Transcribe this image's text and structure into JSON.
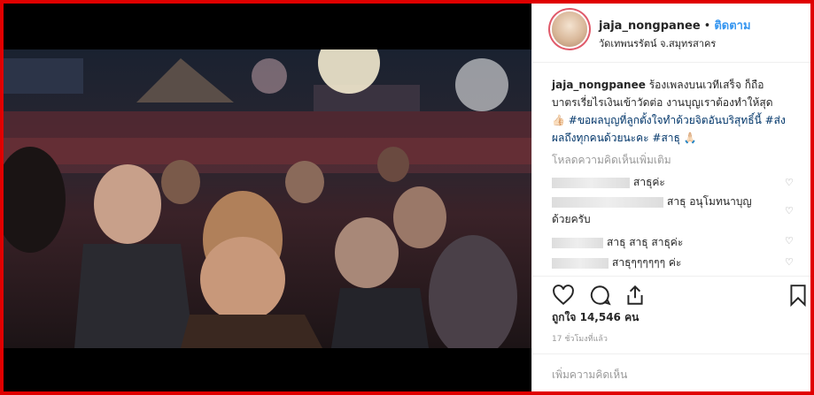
{
  "post": {
    "username": "jaja_nongpanee",
    "follow_label": "ติดตาม",
    "location": "วัดเทพนรรัตน์ จ.สมุทรสาคร",
    "caption_user": "jaja_nongpanee",
    "caption_text": "ร้องเพลงบนเวทีเสร็จ ก็ถือบาตรเรี่ยไรเงินเข้าวัดต่อ งานบุญเราต้องทำให้สุด 👍🏻",
    "caption_tags": "#ขอผลบุญที่ลูกตั้งใจทำด้วยจิตอันบริสุทธิ์นี้ #ส่งผลถึงทุกคนด้วยนะคะ #สาธุ",
    "caption_end": "🙏🏻",
    "load_more": "โหลดความคิดเห็นเพิ่มเติม",
    "comments": [
      {
        "text": "สาธุค่ะ"
      },
      {
        "text": "สาธุ อนุโมทนาบุญ",
        "text2": "ด้วยครับ"
      },
      {
        "text": "สาธุ สาธุ สาธุค่ะ"
      },
      {
        "text": "สาธุๆๆๆๆๆๆ ค่ะ"
      }
    ],
    "likes": "ถูกใจ 14,546 คน",
    "time": "17 ชั่วโมงที่แล้ว",
    "add_comment": "เพิ่มความคิดเห็น"
  },
  "colors": {
    "frame": "#e00000",
    "link": "#3897f0",
    "hashtag": "#003569"
  }
}
